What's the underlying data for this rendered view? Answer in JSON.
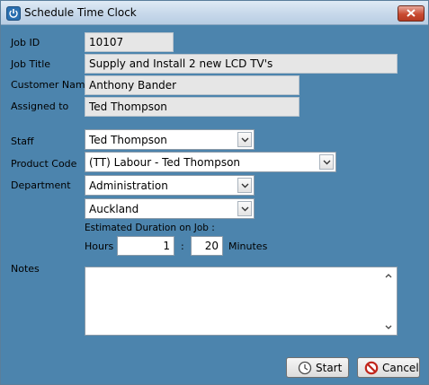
{
  "window": {
    "title": "Schedule Time Clock"
  },
  "labels": {
    "job_id": "Job ID",
    "job_title": "Job Title",
    "customer_name": "Customer Name",
    "assigned_to": "Assigned to",
    "staff": "Staff",
    "product_code": "Product Code",
    "department": "Department",
    "estimated_duration": "Estimated Duration on Job :",
    "hours": "Hours",
    "colon": ":",
    "minutes": "Minutes",
    "notes": "Notes"
  },
  "fields": {
    "job_id": "10107",
    "job_title": "Supply and Install 2 new LCD TV's",
    "customer_name": "Anthony Bander",
    "assigned_to": "Ted Thompson",
    "staff": "Ted Thompson",
    "product_code": "(TT) Labour - Ted Thompson",
    "department": "Administration",
    "location": "Auckland",
    "hours": "1",
    "minutes": "20",
    "notes": ""
  },
  "buttons": {
    "start": "Start",
    "cancel": "Cancel"
  },
  "icons": {
    "app": "power-icon",
    "close": "close-icon",
    "dropdown": "chevron-down-icon",
    "start": "clock-icon",
    "cancel": "no-entry-icon"
  }
}
